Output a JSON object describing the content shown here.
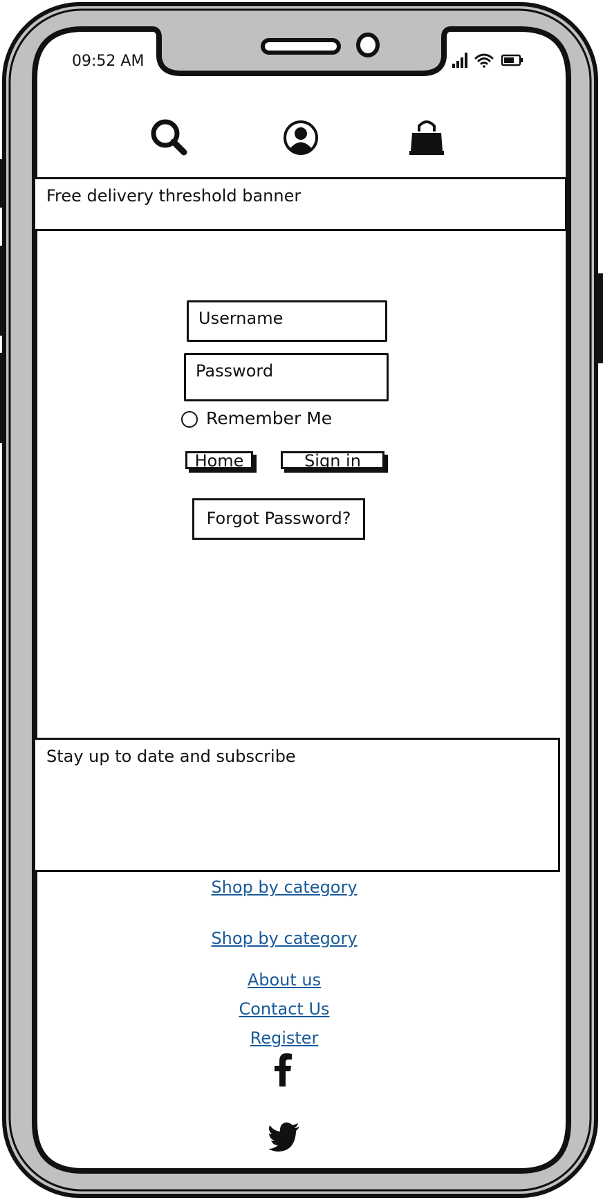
{
  "status_bar": {
    "time": "09:52 AM",
    "icons": [
      "signal-icon",
      "wifi-icon",
      "battery-icon"
    ]
  },
  "header": {
    "icons": [
      "search-icon",
      "account-icon",
      "shopping-bag-icon"
    ]
  },
  "banner": {
    "text": "Free delivery threshold banner"
  },
  "login_form": {
    "username_placeholder": "Username",
    "password_placeholder": "Password",
    "remember_me_label": "Remember Me",
    "home_button": "Home",
    "signin_button": "Sign in",
    "forgot_password_button": "Forgot Password?"
  },
  "subscribe": {
    "text": "Stay up to date and subscribe"
  },
  "footer": {
    "links": [
      "Shop by category",
      "Shop by category",
      "About us",
      "Contact Us",
      "Register"
    ],
    "social_icons": [
      "facebook-icon",
      "twitter-icon"
    ]
  },
  "colors": {
    "link": "#1a5a9a",
    "frame": "#c0c0c0",
    "stroke": "#111111"
  }
}
